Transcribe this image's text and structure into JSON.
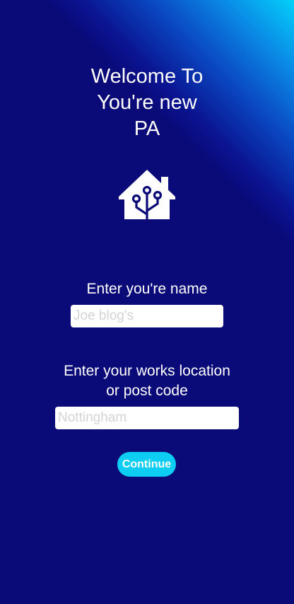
{
  "welcome": {
    "title_lines": [
      "Welcome To",
      "You're new",
      "PA"
    ]
  },
  "logo": {
    "icon": "home-assistant-house-icon"
  },
  "name_section": {
    "label": "Enter you're name",
    "placeholder": "Joe blog's",
    "value": ""
  },
  "location_section": {
    "label_lines": [
      "Enter your works location",
      "or post code"
    ],
    "placeholder": "Nottingham",
    "value": ""
  },
  "actions": {
    "continue_label": "Continue"
  },
  "colors": {
    "background": "#0a0a78",
    "gradient_accent": "#03d0f8",
    "button": "#0dcdf2",
    "text": "#ffffff"
  }
}
